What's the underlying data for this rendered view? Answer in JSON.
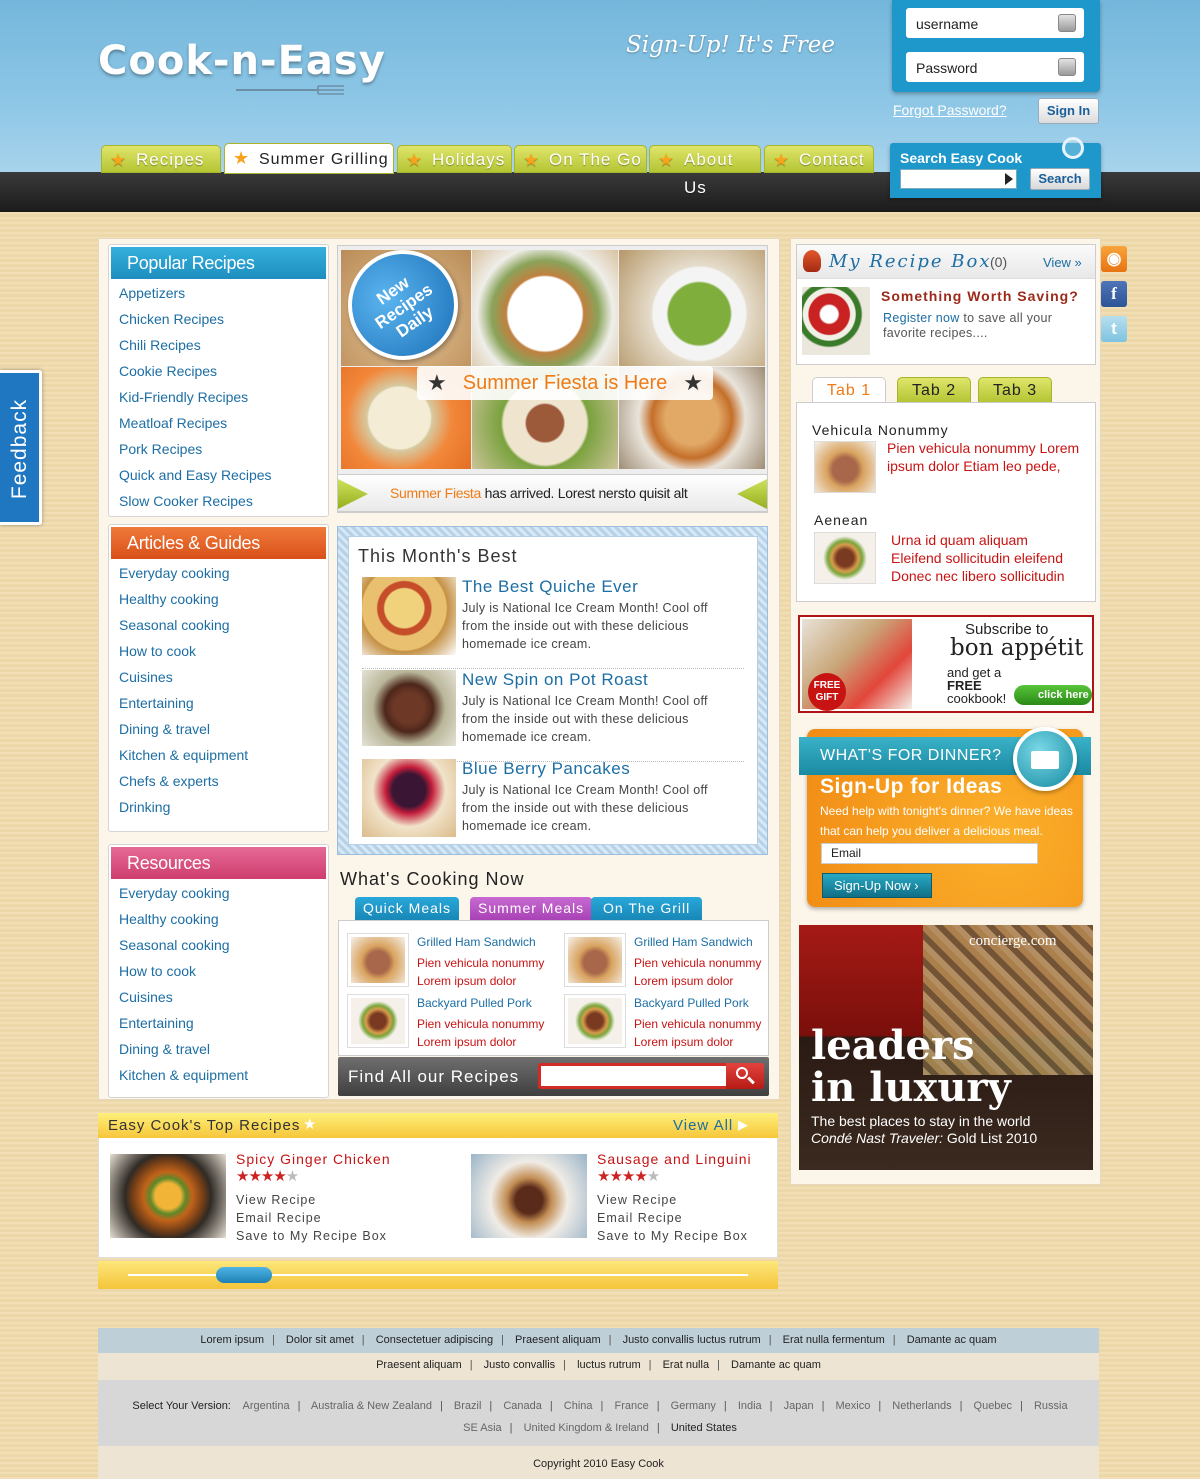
{
  "header": {
    "logo": "Cook-n-Easy",
    "slogan": "Sign-Up! It's Free",
    "login": {
      "username": "username",
      "password": "Password",
      "forgot": "Forgot Password?",
      "signin": "Sign In"
    },
    "search": {
      "title": "Search Easy Cook",
      "button": "Search"
    },
    "nav": [
      "Recipes",
      "Summer Grilling",
      "Holidays",
      "On The Go",
      "About Us",
      "Contact"
    ],
    "nav_active": "Summer Grilling"
  },
  "feedback": "Feedback",
  "sidebar": {
    "popular": {
      "title": "Popular Recipes",
      "color": "#1e93c3",
      "items": [
        "Appetizers",
        "Chicken Recipes",
        "Chili Recipes",
        "Cookie Recipes",
        "Kid-Friendly Recipes",
        "Meatloaf Recipes",
        "Pork Recipes",
        "Quick and Easy Recipes",
        "Slow Cooker Recipes"
      ]
    },
    "articles": {
      "title": "Articles & Guides",
      "color": "#e05c22",
      "items": [
        "Everyday cooking",
        "Healthy cooking",
        "Seasonal cooking",
        "How to cook",
        "Cuisines",
        "Entertaining",
        "Dining & travel",
        "Kitchen & equipment",
        "Chefs & experts",
        "Drinking"
      ]
    },
    "resources": {
      "title": "Resources",
      "color": "#d7457a",
      "items": [
        "Everyday cooking",
        "Healthy cooking",
        "Seasonal cooking",
        "How to cook",
        "Cuisines",
        "Entertaining",
        "Dining & travel",
        "Kitchen & equipment"
      ]
    }
  },
  "slider": {
    "badge": "New Recipes Daily",
    "banner": "Summer Fiesta is Here",
    "ticker_highlight": "Summer Fiesta",
    "ticker_text": " has arrived. Lorest nersto quisit alt"
  },
  "best": {
    "title": "This Month's Best",
    "items": [
      {
        "title": "The Best Quiche Ever",
        "desc": "July is National Ice Cream Month! Cool off from the inside out with these delicious homemade ice cream."
      },
      {
        "title": "New Spin on Pot Roast",
        "desc": "July is National Ice Cream Month! Cool off from the inside out with these delicious homemade ice cream."
      },
      {
        "title": "Blue Berry Pancakes",
        "desc": "July is National Ice Cream Month! Cool off from the inside out with these delicious homemade ice cream."
      }
    ]
  },
  "cooking": {
    "title": "What's Cooking Now",
    "tabs": [
      "Quick Meals",
      "Summer Meals",
      "On The Grill"
    ],
    "items": [
      {
        "name": "Grilled Ham Sandwich",
        "line1": "Pien vehicula nonummy",
        "line2": "Lorem ipsum dolor"
      },
      {
        "name": "Grilled Ham Sandwich",
        "line1": "Pien vehicula nonummy",
        "line2": "Lorem ipsum dolor"
      },
      {
        "name": "Backyard Pulled Pork",
        "line1": "Pien vehicula nonummy",
        "line2": "Lorem ipsum dolor"
      },
      {
        "name": "Backyard Pulled Pork",
        "line1": "Pien vehicula nonummy",
        "line2": "Lorem ipsum dolor"
      }
    ],
    "find_label": "Find All our Recipes"
  },
  "top_recipes": {
    "title": "Easy Cook's Top Recipes",
    "view_all": "View All",
    "items": [
      {
        "name": "Spicy Ginger Chicken",
        "rating": 4,
        "links": [
          "View Recipe",
          "Email Recipe",
          "Save to My Recipe Box"
        ]
      },
      {
        "name": "Sausage and Linguini",
        "rating": 4,
        "links": [
          "View Recipe",
          "Email Recipe",
          "Save to My Recipe Box"
        ]
      }
    ]
  },
  "recipe_box": {
    "title": "My Recipe Box",
    "count": "(0)",
    "view": "View »",
    "headline": "Something Worth Saving?",
    "register": "Register now",
    "register_rest": " to save all your favorite recipes...."
  },
  "right_tabs": {
    "tabs": [
      "Tab 1",
      "Tab 2",
      "Tab 3"
    ],
    "items": [
      {
        "heading": "Vehicula Nonummy",
        "text": "Pien vehicula nonummy Lorem ipsum dolor Etiam leo pede,"
      },
      {
        "heading": "Aenean",
        "text": "Urna id quam aliquam Eleifend sollicitudin eleifend Donec nec libero sollicitudin"
      }
    ]
  },
  "ad_bonappetit": {
    "subscribe": "Subscribe to",
    "brand": "bon appétit",
    "offer": "and get a",
    "free": "FREE",
    "cookbook": "cookbook!",
    "gift": "FREE GIFT",
    "click": "click here"
  },
  "dinner": {
    "head": "WHAT'S FOR DINNER?",
    "title": "Sign-Up for Ideas",
    "desc": "Need help with tonight's dinner? We have ideas that can help you deliver a delicious meal.",
    "email_placeholder": "Email",
    "button": "Sign-Up Now"
  },
  "ad_concierge": {
    "brand": "concierge.com",
    "headline1": "leaders",
    "headline2": "in luxury",
    "sub1": "The best places to stay in the world",
    "sub2_italic": "Condé Nast Traveler:",
    "sub2_rest": " Gold List 2010"
  },
  "footer": {
    "row1": [
      "Lorem ipsum",
      "Dolor sit amet",
      "Consectetuer adipiscing",
      "Praesent aliquam",
      "Justo convallis luctus rutrum",
      "Erat nulla fermentum",
      "Damante ac quam"
    ],
    "row2": [
      "Praesent aliquam",
      "Justo convallis",
      "luctus rutrum",
      "Erat nulla",
      "Damante ac quam"
    ],
    "version_label": "Select Your Version:",
    "versions": [
      "Argentina",
      "Australia & New Zealand",
      "Brazil",
      "Canada",
      "China",
      "France",
      "Germany",
      "India",
      "Japan",
      "Mexico",
      "Netherlands",
      "Quebec",
      "Russia",
      "SE Asia",
      "United Kingdom & Ireland",
      "United States"
    ],
    "copyright": "Copyright 2010 Easy Cook"
  }
}
